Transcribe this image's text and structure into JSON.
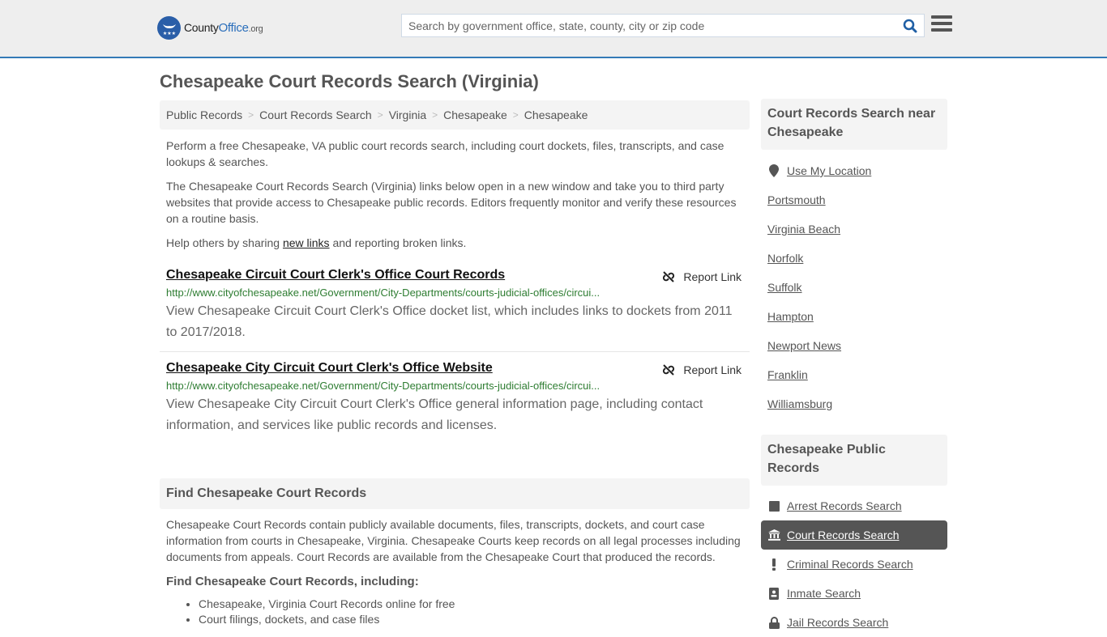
{
  "header": {
    "logo": {
      "name": "CountyOffice",
      "name_part1": "County",
      "name_part2": "Office",
      "tld": ".org"
    },
    "search": {
      "placeholder": "Search by government office, state, county, city or zip code",
      "value": ""
    },
    "icons": {
      "search": "search-icon",
      "menu": "hamburger-menu-icon"
    }
  },
  "page": {
    "title": "Chesapeake Court Records Search (Virginia)"
  },
  "breadcrumb": [
    "Public Records",
    "Court Records Search",
    "Virginia",
    "Chesapeake",
    "Chesapeake"
  ],
  "intro": {
    "p1": "Perform a free Chesapeake, VA public court records search, including court dockets, files, transcripts, and case lookups & searches.",
    "p2": "The Chesapeake Court Records Search (Virginia) links below open in a new window and take you to third party websites that provide access to Chesapeake public records. Editors frequently monitor and verify these resources on a routine basis.",
    "p3_before": "Help others by sharing ",
    "p3_link": "new links",
    "p3_after": " and reporting broken links."
  },
  "results": [
    {
      "title": "Chesapeake Circuit Court Clerk's Office Court Records",
      "url": "http://www.cityofchesapeake.net/Government/City-Departments/courts-judicial-offices/circui...",
      "description": "View Chesapeake Circuit Court Clerk's Office docket list, which includes links to dockets from 2011 to 2017/2018.",
      "report_label": "Report Link"
    },
    {
      "title": "Chesapeake City Circuit Court Clerk's Office Website",
      "url": "http://www.cityofchesapeake.net/Government/City-Departments/courts-judicial-offices/circui...",
      "description": "View Chesapeake City Circuit Court Clerk's Office general information page, including contact information, and services like public records and licenses.",
      "report_label": "Report Link"
    }
  ],
  "find_section": {
    "heading": "Find Chesapeake Court Records",
    "body": "Chesapeake Court Records contain publicly available documents, files, transcripts, dockets, and court case information from courts in Chesapeake, Virginia. Chesapeake Courts keep records on all legal processes including documents from appeals. Court Records are available from the Chesapeake Court that produced the records.",
    "subheading": "Find Chesapeake Court Records, including:",
    "bullets": [
      "Chesapeake, Virginia Court Records online for free",
      "Court filings, dockets, and case files"
    ]
  },
  "sidebar": {
    "nearby": {
      "heading": "Court Records Search near Chesapeake",
      "use_location": "Use My Location",
      "cities": [
        "Portsmouth",
        "Virginia Beach",
        "Norfolk",
        "Suffolk",
        "Hampton",
        "Newport News",
        "Franklin",
        "Williamsburg"
      ]
    },
    "public_records": {
      "heading": "Chesapeake Public Records",
      "items": [
        {
          "label": "Arrest Records Search",
          "icon": "square-icon",
          "active": false
        },
        {
          "label": "Court Records Search",
          "icon": "courthouse-icon",
          "active": true
        },
        {
          "label": "Criminal Records Search",
          "icon": "exclamation-icon",
          "active": false
        },
        {
          "label": "Inmate Search",
          "icon": "id-badge-icon",
          "active": false
        },
        {
          "label": "Jail Records Search",
          "icon": "lock-icon",
          "active": false
        }
      ]
    }
  },
  "colors": {
    "accent": "#337ab7",
    "link_green": "#2e7d32",
    "active_bg": "#555555",
    "logo_blue": "#2a5ea8"
  }
}
